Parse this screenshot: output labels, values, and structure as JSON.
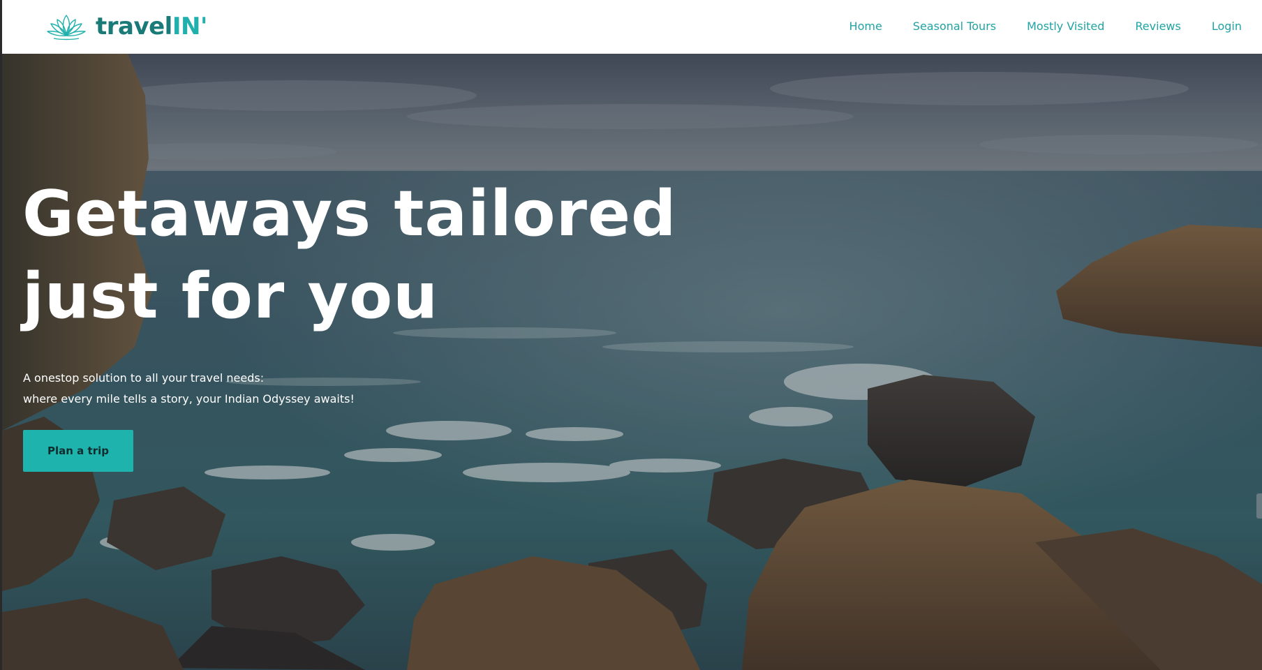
{
  "brand": {
    "name_main": "travel",
    "name_accent": "IN'",
    "logo_icon": "lotus-icon",
    "primary_color": "#1a7a78",
    "accent_color": "#22b0ad"
  },
  "nav": {
    "items": [
      {
        "label": "Home"
      },
      {
        "label": "Seasonal Tours"
      },
      {
        "label": "Mostly Visited"
      },
      {
        "label": "Reviews"
      },
      {
        "label": "Login"
      }
    ],
    "link_color": "#21a3a3"
  },
  "hero": {
    "title_line1": "Getaways tailored",
    "title_line2": "just for you",
    "subtitle_line1": "A onestop solution to all your travel needs:",
    "subtitle_line2": "where every mile tells a story, your Indian Odyssey awaits!",
    "cta_label": "Plan a trip",
    "cta_color": "#1fb3ae"
  }
}
